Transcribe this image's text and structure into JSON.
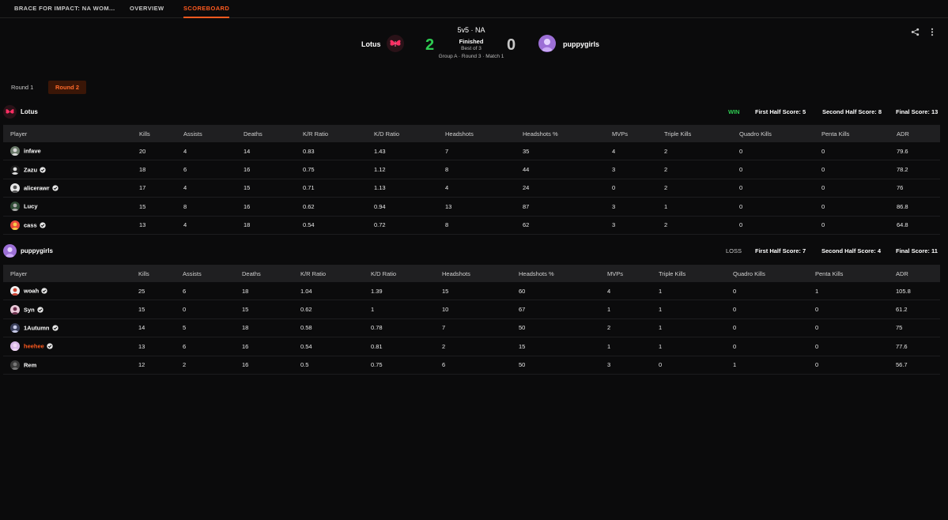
{
  "nav": {
    "tabs": [
      {
        "label": "BRACE FOR IMPACT: NA WOM..."
      },
      {
        "label": "OVERVIEW"
      },
      {
        "label": "SCOREBOARD"
      }
    ]
  },
  "match": {
    "format": "5v5 · NA",
    "status": "Finished",
    "best_of": "Best of 3",
    "stage": "Group A · Round 3 · Match 1",
    "team1": {
      "name": "Lotus",
      "score": "2"
    },
    "team2": {
      "name": "puppygirls",
      "score": "0"
    },
    "colors": {
      "win": "#2ecc52",
      "accent": "#ff5a1f"
    }
  },
  "rounds": {
    "round1": "Round 1",
    "round2": "Round 2",
    "selected": "Round 2"
  },
  "columns": [
    "Player",
    "Kills",
    "Assists",
    "Deaths",
    "K/R Ratio",
    "K/D Ratio",
    "Headshots",
    "Headshots %",
    "MVPs",
    "Triple Kills",
    "Quadro Kills",
    "Penta Kills",
    "ADR"
  ],
  "teams": [
    {
      "name": "Lotus",
      "result": "WIN",
      "first_half": "First Half Score: 5",
      "second_half": "Second Half Score: 8",
      "final": "Final Score: 13",
      "players": [
        {
          "name": "infave",
          "verified": false,
          "stats": [
            "20",
            "4",
            "14",
            "0.83",
            "1.43",
            "7",
            "35",
            "4",
            "2",
            "0",
            "0",
            "79.6"
          ]
        },
        {
          "name": "Zazu",
          "verified": true,
          "stats": [
            "18",
            "6",
            "16",
            "0.75",
            "1.12",
            "8",
            "44",
            "3",
            "2",
            "0",
            "0",
            "78.2"
          ]
        },
        {
          "name": "alicerawr",
          "verified": true,
          "stats": [
            "17",
            "4",
            "15",
            "0.71",
            "1.13",
            "4",
            "24",
            "0",
            "2",
            "0",
            "0",
            "76"
          ]
        },
        {
          "name": "Lucy",
          "verified": false,
          "stats": [
            "15",
            "8",
            "16",
            "0.62",
            "0.94",
            "13",
            "87",
            "3",
            "1",
            "0",
            "0",
            "86.8"
          ]
        },
        {
          "name": "cass",
          "verified": true,
          "stats": [
            "13",
            "4",
            "18",
            "0.54",
            "0.72",
            "8",
            "62",
            "3",
            "2",
            "0",
            "0",
            "64.8"
          ]
        }
      ]
    },
    {
      "name": "puppygirls",
      "result": "LOSS",
      "first_half": "First Half Score: 7",
      "second_half": "Second Half Score: 4",
      "final": "Final Score: 11",
      "players": [
        {
          "name": "woah",
          "verified": true,
          "stats": [
            "25",
            "6",
            "18",
            "1.04",
            "1.39",
            "15",
            "60",
            "4",
            "1",
            "0",
            "1",
            "105.8"
          ]
        },
        {
          "name": "Syn",
          "verified": true,
          "stats": [
            "15",
            "0",
            "15",
            "0.62",
            "1",
            "10",
            "67",
            "1",
            "1",
            "0",
            "0",
            "61.2"
          ]
        },
        {
          "name": "1Autumn",
          "verified": true,
          "stats": [
            "14",
            "5",
            "18",
            "0.58",
            "0.78",
            "7",
            "50",
            "2",
            "1",
            "0",
            "0",
            "75"
          ]
        },
        {
          "name": "heehee",
          "verified": true,
          "highlight": true,
          "stats": [
            "13",
            "6",
            "16",
            "0.54",
            "0.81",
            "2",
            "15",
            "1",
            "1",
            "0",
            "0",
            "77.6"
          ]
        },
        {
          "name": "Rem",
          "verified": false,
          "stats": [
            "12",
            "2",
            "16",
            "0.5",
            "0.75",
            "6",
            "50",
            "3",
            "0",
            "1",
            "0",
            "56.7"
          ]
        }
      ]
    }
  ]
}
